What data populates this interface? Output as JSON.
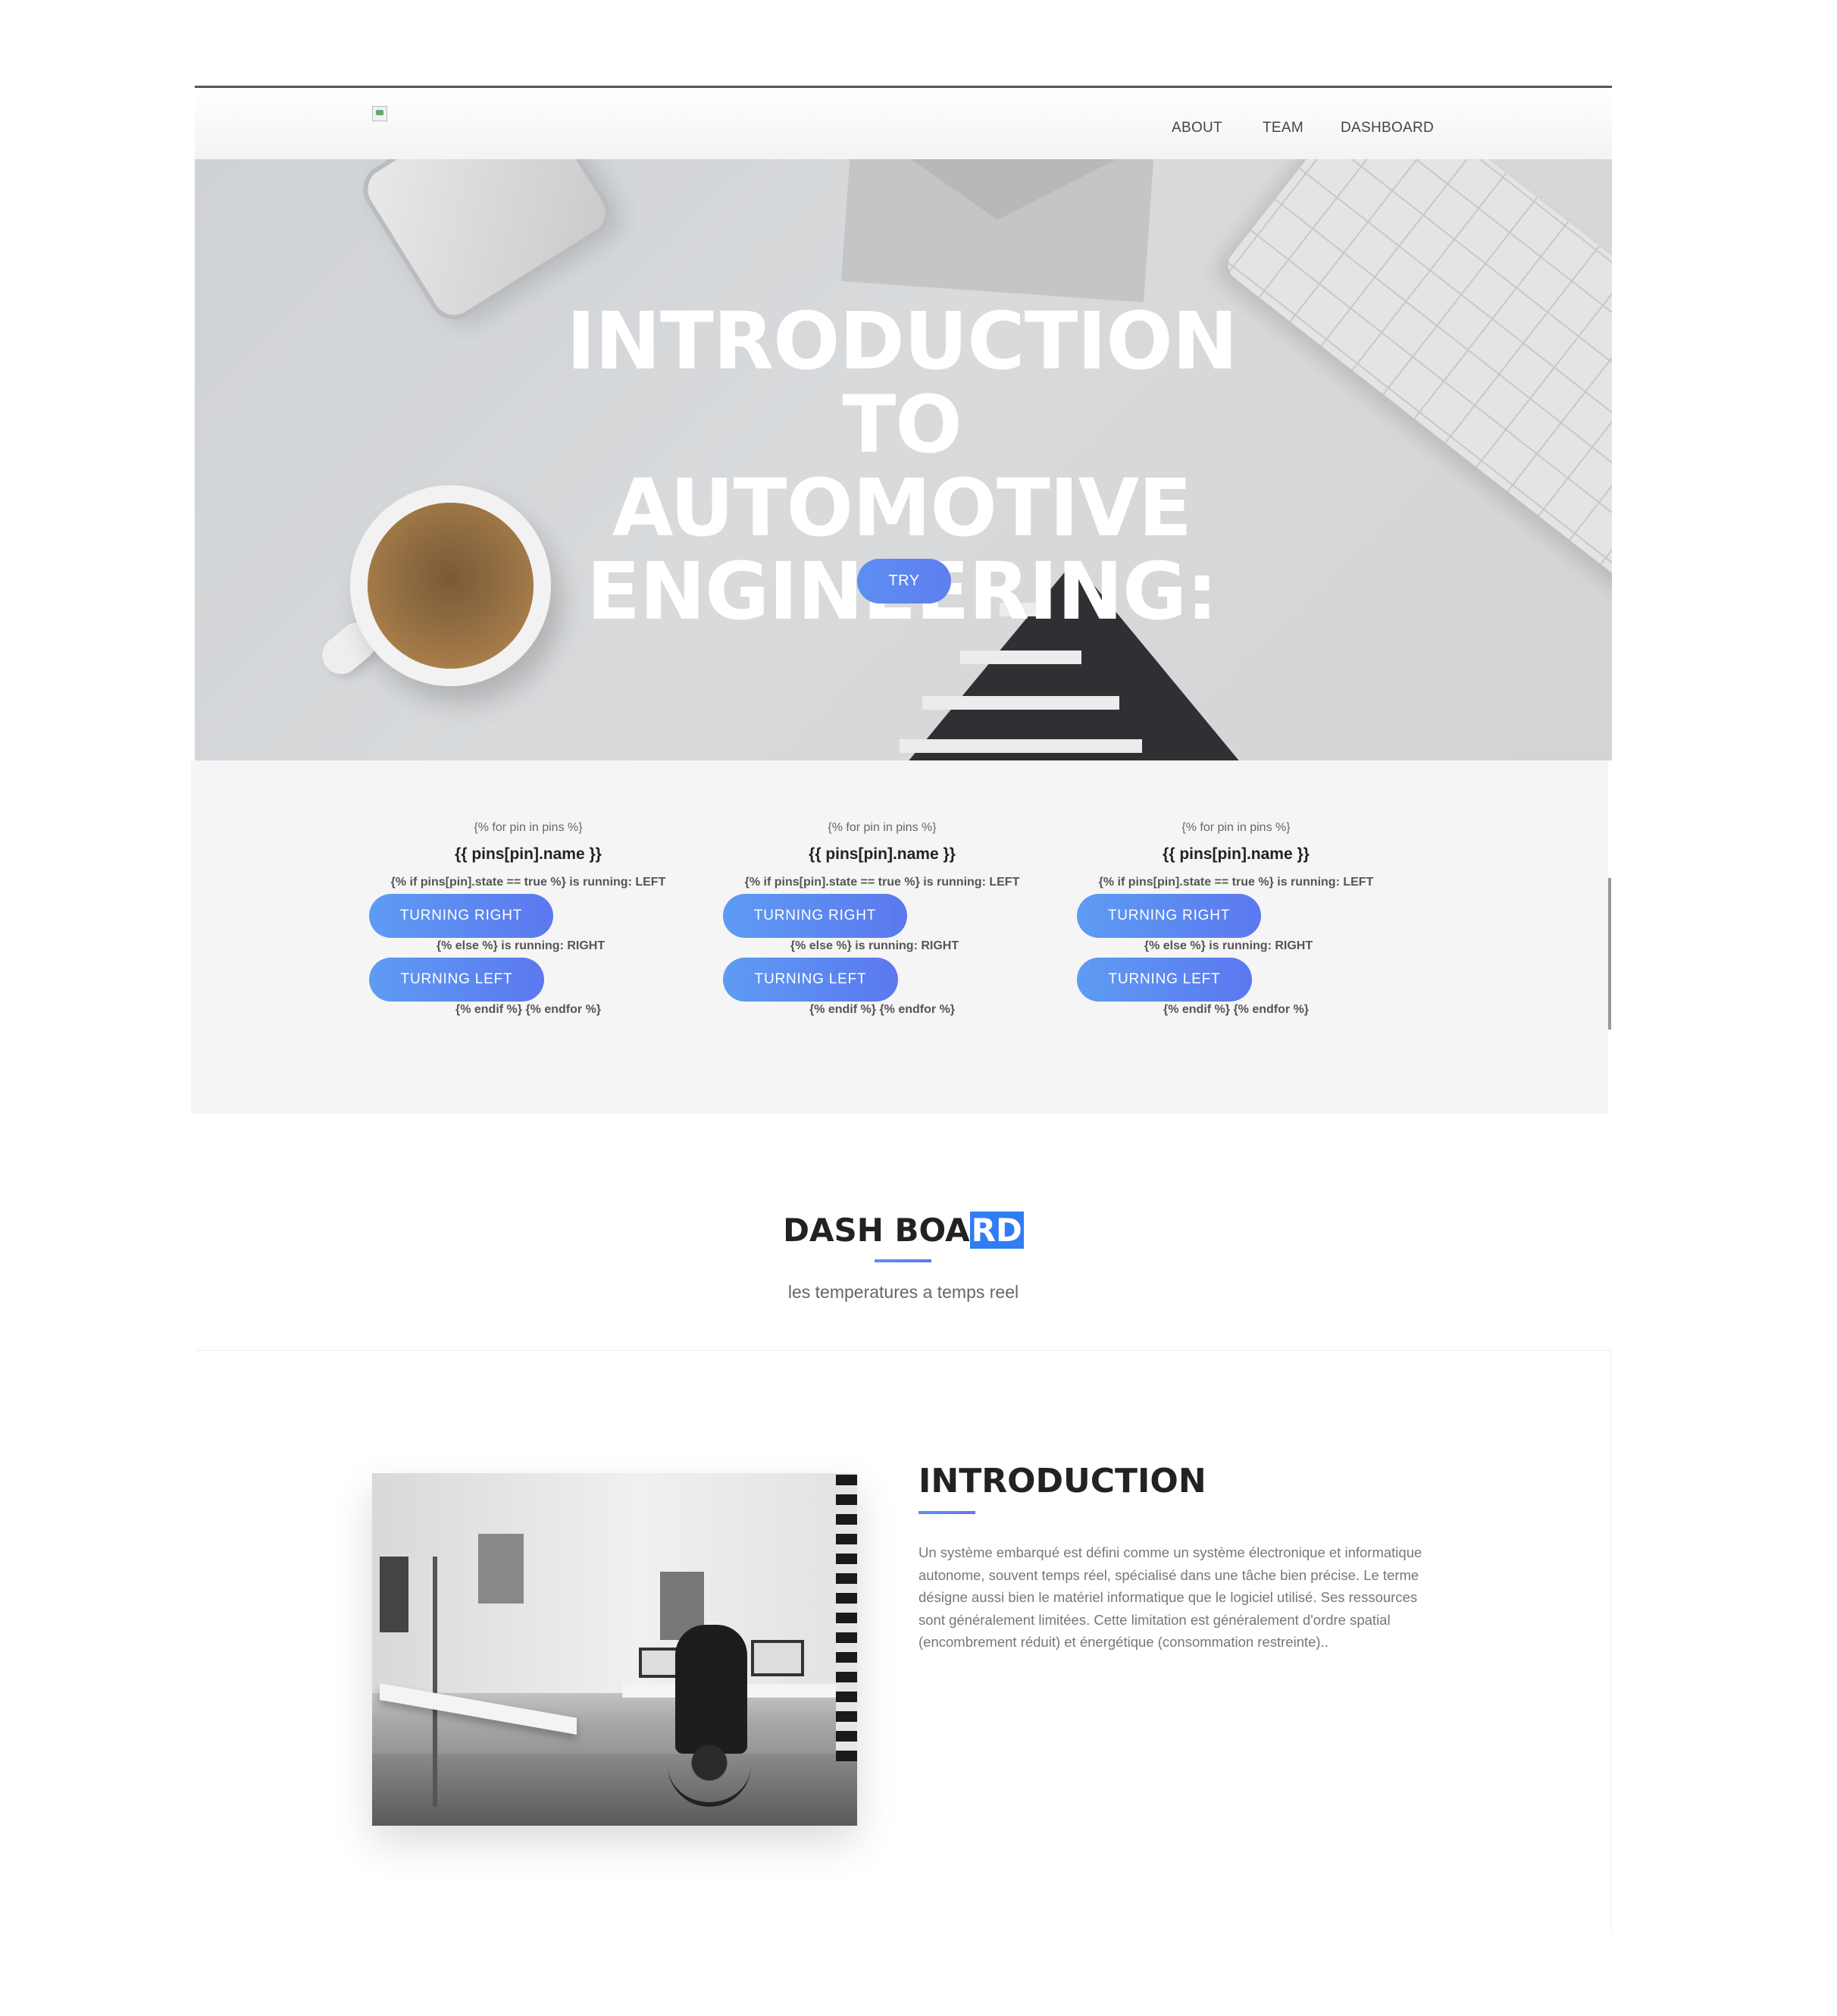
{
  "nav": {
    "about": "ABOUT",
    "team": "TEAM",
    "dashboard": "DASHBOARD"
  },
  "hero": {
    "title_lines": [
      "INTRODUCTION",
      "TO AUTOMOTIVE",
      "ENGINEERING:"
    ],
    "try_label": "TRY"
  },
  "pins": {
    "columns": [
      {
        "loop": "{% for pin in pins %}",
        "name": "{{ pins[pin].name }}",
        "if_line": "{% if pins[pin].state == true %} is running: LEFT",
        "right_button": "TURNING RIGHT",
        "else_line": "{% else %} is running: RIGHT",
        "left_button": "TURNING LEFT",
        "end_line": "{% endif %} {% endfor %}"
      },
      {
        "loop": "{% for pin in pins %}",
        "name": "{{ pins[pin].name }}",
        "if_line": "{% if pins[pin].state == true %} is running: LEFT",
        "right_button": "TURNING RIGHT",
        "else_line": "{% else %} is running: RIGHT",
        "left_button": "TURNING LEFT",
        "end_line": "{% endif %} {% endfor %}"
      },
      {
        "loop": "{% for pin in pins %}",
        "name": "{{ pins[pin].name }}",
        "if_line": "{% if pins[pin].state == true %} is running: LEFT",
        "right_button": "TURNING RIGHT",
        "else_line": "{% else %} is running: RIGHT",
        "left_button": "TURNING LEFT",
        "end_line": "{% endif %} {% endfor %}"
      }
    ]
  },
  "dashboard": {
    "title_plain": "DASH BOA",
    "title_highlight": "RD",
    "subtitle": "les temperatures a temps reel"
  },
  "introduction": {
    "title": "INTRODUCTION",
    "text": "Un système embarqué est défini comme un système électronique et informatique autonome, souvent temps réel, spécialisé dans une tâche bien précise. Le terme désigne aussi bien le matériel informatique que le logiciel utilisé. Ses ressources sont généralement limitées. Cette limitation est généralement d'ordre spatial (encombrement réduit) et énergétique (consommation restreinte).."
  },
  "colors": {
    "accent_start": "#5d9cf3",
    "accent_end": "#5c78ef",
    "highlight": "#2f7cf5",
    "section_bg": "#f5f5f5"
  }
}
